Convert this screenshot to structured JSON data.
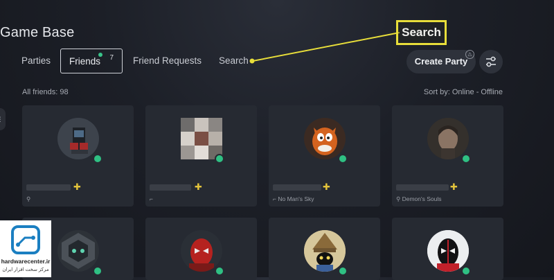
{
  "page": {
    "title": "Game Base"
  },
  "tabs": [
    {
      "label": "Parties"
    },
    {
      "label": "Friends",
      "badge": "7"
    },
    {
      "label": "Friend Requests"
    },
    {
      "label": "Search"
    }
  ],
  "actions": {
    "create_party": "Create Party",
    "filter_icon": "sliders-icon"
  },
  "list": {
    "count_text": "All friends: 98",
    "sort_text": "Sort by: Online - Offline"
  },
  "callout": {
    "text": "Search",
    "color": "#e8de3a"
  },
  "friends": [
    {
      "avatar": "arcade-cabinet",
      "online": true,
      "game": "",
      "status_icon": "boot-icon"
    },
    {
      "avatar": "pixelated",
      "online": true,
      "game": "",
      "status_icon": "controller-icon"
    },
    {
      "avatar": "crash-bandicoot",
      "online": true,
      "game": "No Man's Sky",
      "status_icon": "controller-icon"
    },
    {
      "avatar": "joel",
      "online": true,
      "game": "Demon's Souls",
      "status_icon": "boot-icon"
    },
    {
      "avatar": "dark-emblem",
      "online": true,
      "game": "",
      "status_icon": ""
    },
    {
      "avatar": "spider-man",
      "online": true,
      "game": "",
      "status_icon": ""
    },
    {
      "avatar": "black-mage",
      "online": true,
      "game": "",
      "status_icon": ""
    },
    {
      "avatar": "miles-morales",
      "online": true,
      "game": "",
      "status_icon": ""
    }
  ],
  "watermark": {
    "brand": "hardwarecenter.ir",
    "tagline": "مرکز سخت افزار ایران"
  },
  "colors": {
    "accent": "#e8de3a",
    "online": "#2fc083",
    "background": "#1c1f27"
  }
}
